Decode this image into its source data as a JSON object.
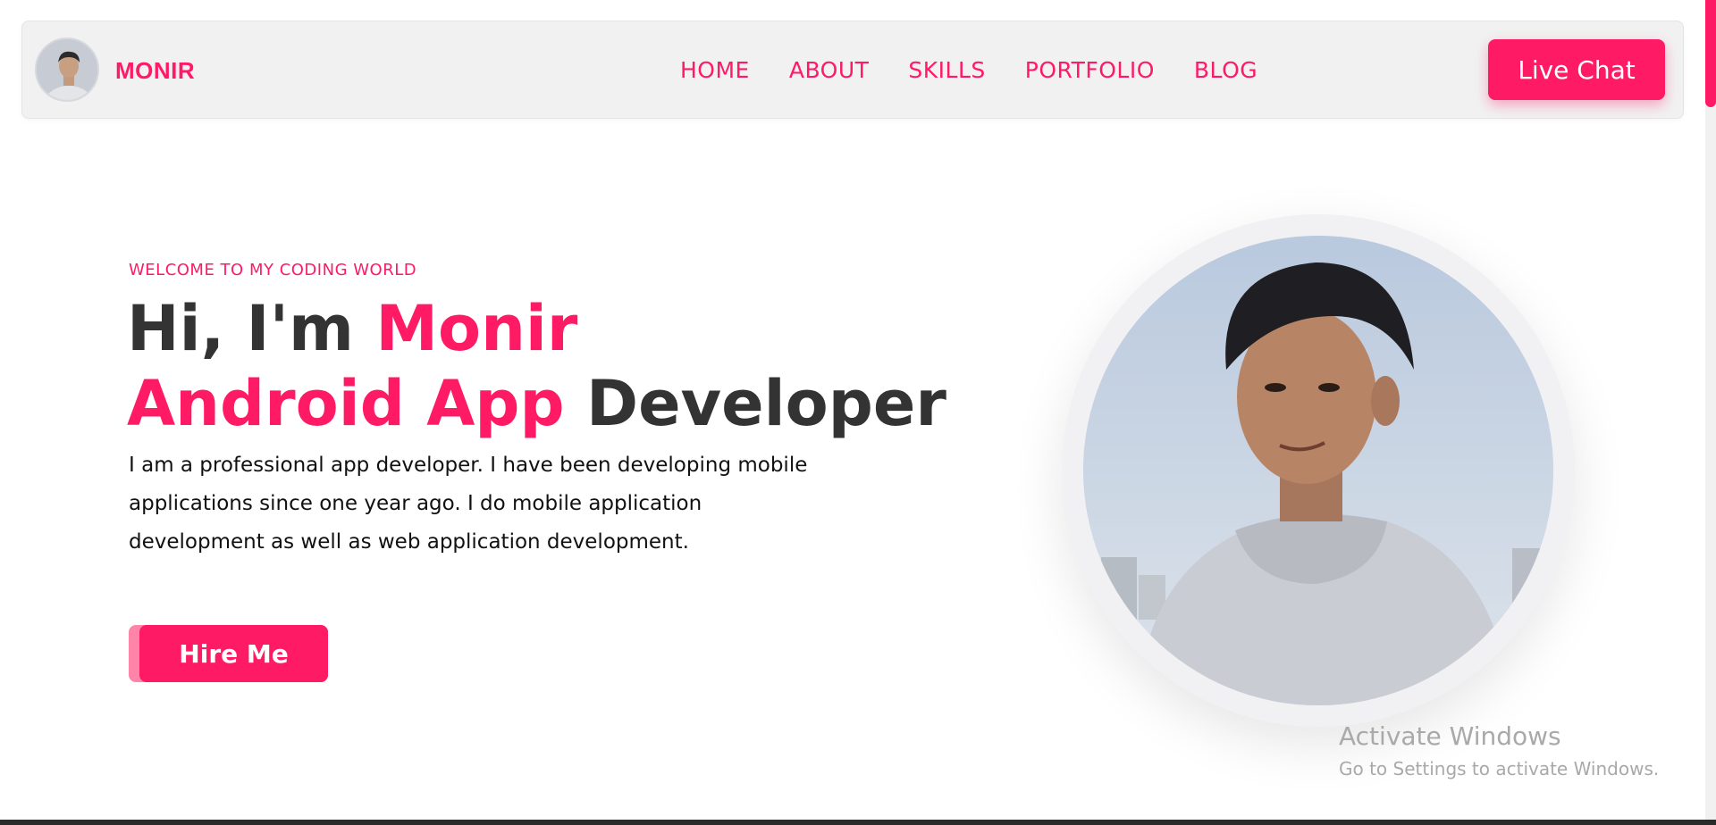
{
  "brand": {
    "name": "MONIR"
  },
  "nav": {
    "items": [
      {
        "label": "HOME"
      },
      {
        "label": "ABOUT"
      },
      {
        "label": "SKILLS"
      },
      {
        "label": "PORTFOLIO"
      },
      {
        "label": "BLOG"
      }
    ],
    "cta_label": "Live Chat"
  },
  "hero": {
    "welcome": "WELCOME TO MY CODING WORLD",
    "title_prefix": "Hi, I'm ",
    "title_name": "Monir",
    "role_highlight": "Android App",
    "role_rest": " Developer",
    "description": "I am a professional app developer. I have been developing mobile applications since one year ago. I do mobile application development as well as web application development.",
    "hire_label": "Hire Me"
  },
  "watermark": {
    "title": "Activate Windows",
    "subtitle": "Go to Settings to activate Windows."
  },
  "colors": {
    "accent": "#ff1a66",
    "accent_light": "#ff85a8",
    "text_dark": "#333333",
    "navbar_bg": "#f1f1f1"
  },
  "icons": {
    "avatar": "profile-photo",
    "portrait": "portrait-photo"
  }
}
